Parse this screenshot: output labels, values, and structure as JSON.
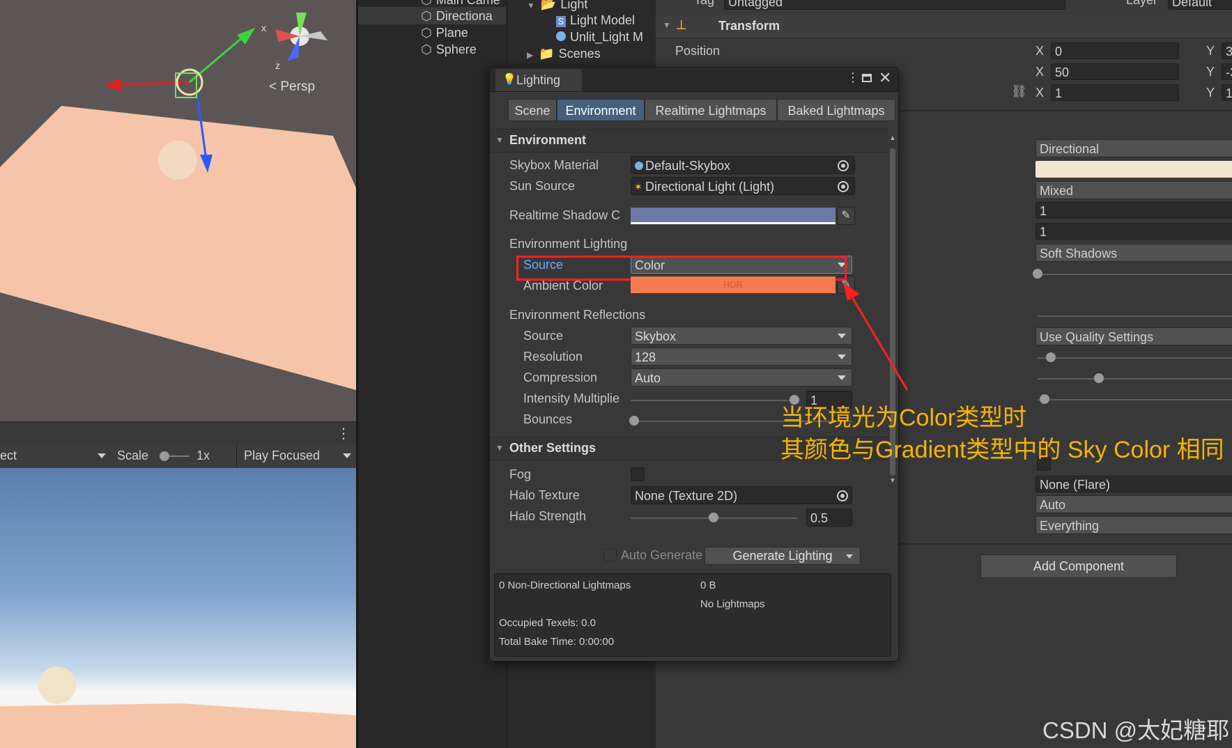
{
  "scene": {
    "persp_label": "Persp",
    "gizmo_axes": {
      "x": "x",
      "z": "z"
    }
  },
  "game_toolbar": {
    "display_partial": "ect",
    "scale_label": "Scale",
    "scale_value": "1x",
    "play_mode": "Play Focused"
  },
  "hierarchy": {
    "items": [
      {
        "label": "Main Came"
      },
      {
        "label": "Directiona"
      },
      {
        "label": "Plane"
      },
      {
        "label": "Sphere"
      }
    ]
  },
  "project": {
    "items": [
      {
        "label": "Light",
        "icon": "folder-icon"
      },
      {
        "label": "Light Model",
        "icon": "shader-icon"
      },
      {
        "label": "Unlit_Light M",
        "icon": "material-icon"
      },
      {
        "label": "Scenes",
        "icon": "folder-icon"
      }
    ]
  },
  "inspector": {
    "top_partial": {
      "tag_label": "Tag",
      "tag_value": "Untagged",
      "layer_label": "Layer",
      "layer_value": "Default"
    },
    "transform_title": "Transform",
    "position_label": "Position",
    "rows": [
      {
        "x_label": "X",
        "x": "0",
        "y_label": "Y",
        "y": "3"
      },
      {
        "x_label": "X",
        "x": "50",
        "y_label": "Y",
        "y": "-3"
      },
      {
        "x_label": "X",
        "x": "1",
        "y_label": "Y",
        "y": "1"
      }
    ],
    "light_values": [
      "Directional",
      "",
      "Mixed",
      "1",
      "1",
      "Soft Shadows"
    ],
    "quality": "Use Quality Settings",
    "flare": "None (Flare)",
    "render_mode": "Auto",
    "culling": "Everything",
    "add_component": "Add Component"
  },
  "lighting": {
    "title": "Lighting",
    "tabs": [
      "Scene",
      "Environment",
      "Realtime Lightmaps",
      "Baked Lightmaps"
    ],
    "active_tab": "Environment",
    "environment_header": "Environment",
    "skybox_label": "Skybox Material",
    "skybox_value": "Default-Skybox",
    "sun_label": "Sun Source",
    "sun_value": "Directional Light (Light)",
    "shadow_label": "Realtime Shadow C",
    "shadow_color": "#6b7aa8",
    "env_lighting_header": "Environment Lighting",
    "source_label": "Source",
    "source_value": "Color",
    "ambient_label": "Ambient Color",
    "ambient_color": "#f47a4f",
    "ambient_hdr": "HDR",
    "env_reflections_header": "Environment Reflections",
    "refl_source_label": "Source",
    "refl_source_value": "Skybox",
    "resolution_label": "Resolution",
    "resolution_value": "128",
    "compression_label": "Compression",
    "compression_value": "Auto",
    "intensity_label": "Intensity Multiplie",
    "intensity_value": "1",
    "bounces_label": "Bounces",
    "other_header": "Other Settings",
    "fog_label": "Fog",
    "halo_tex_label": "Halo Texture",
    "halo_tex_value": "None (Texture 2D)",
    "halo_strength_label": "Halo Strength",
    "halo_strength_value": "0.5",
    "auto_generate_label": "Auto Generate",
    "generate_button": "Generate Lighting",
    "info": {
      "non_directional": "0 Non-Directional Lightmaps",
      "size": "0 B",
      "no_lightmaps": "No Lightmaps",
      "texels": "Occupied Texels: 0.0",
      "bake_time": "Total Bake Time: 0:00:00"
    }
  },
  "annotation": {
    "line1": "当环境光为Color类型时",
    "line2": "其颜色与Gradient类型中的 Sky Color 相同",
    "color": "#f5b400"
  },
  "watermark": "CSDN @太妃糖耶"
}
